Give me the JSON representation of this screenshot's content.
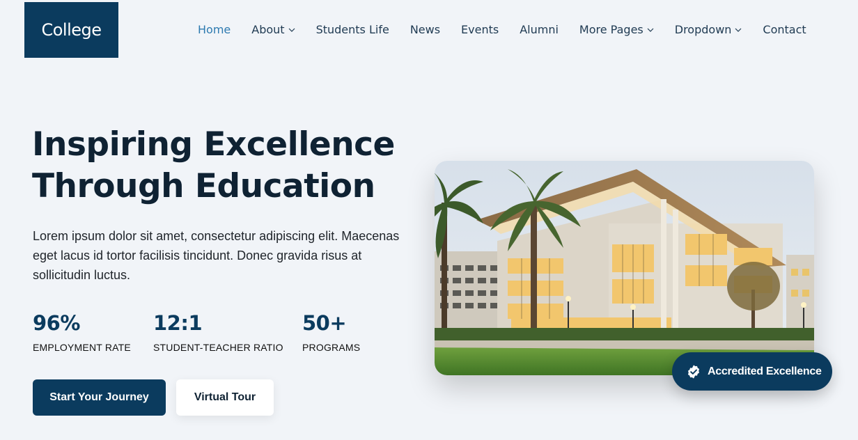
{
  "brand": {
    "logo_text": "College"
  },
  "nav": {
    "items": [
      {
        "label": "Home",
        "active": true,
        "has_dropdown": false
      },
      {
        "label": "About",
        "active": false,
        "has_dropdown": true
      },
      {
        "label": "Students Life",
        "active": false,
        "has_dropdown": false
      },
      {
        "label": "News",
        "active": false,
        "has_dropdown": false
      },
      {
        "label": "Events",
        "active": false,
        "has_dropdown": false
      },
      {
        "label": "Alumni",
        "active": false,
        "has_dropdown": false
      },
      {
        "label": "More Pages",
        "active": false,
        "has_dropdown": true
      },
      {
        "label": "Dropdown",
        "active": false,
        "has_dropdown": true
      },
      {
        "label": "Contact",
        "active": false,
        "has_dropdown": false
      }
    ]
  },
  "hero": {
    "title_line1": "Inspiring Excellence",
    "title_line2": "Through Education",
    "description": "Lorem ipsum dolor sit amet, consectetur adipiscing elit. Maecenas eget lacus id tortor facilisis tincidunt. Donec gravida risus at sollicitudin luctus.",
    "stats": [
      {
        "value": "96%",
        "label": "EMPLOYMENT RATE"
      },
      {
        "value": "12:1",
        "label": "STUDENT-TEACHER RATIO"
      },
      {
        "value": "50+",
        "label": "PROGRAMS"
      }
    ],
    "primary_button": "Start Your Journey",
    "secondary_button": "Virtual Tour"
  },
  "badge": {
    "label": "Accredited Excellence",
    "icon": "verified-check-icon"
  },
  "colors": {
    "primary": "#0b3b5e",
    "nav_active": "#2d7ab0",
    "background": "#f1f4f8"
  }
}
